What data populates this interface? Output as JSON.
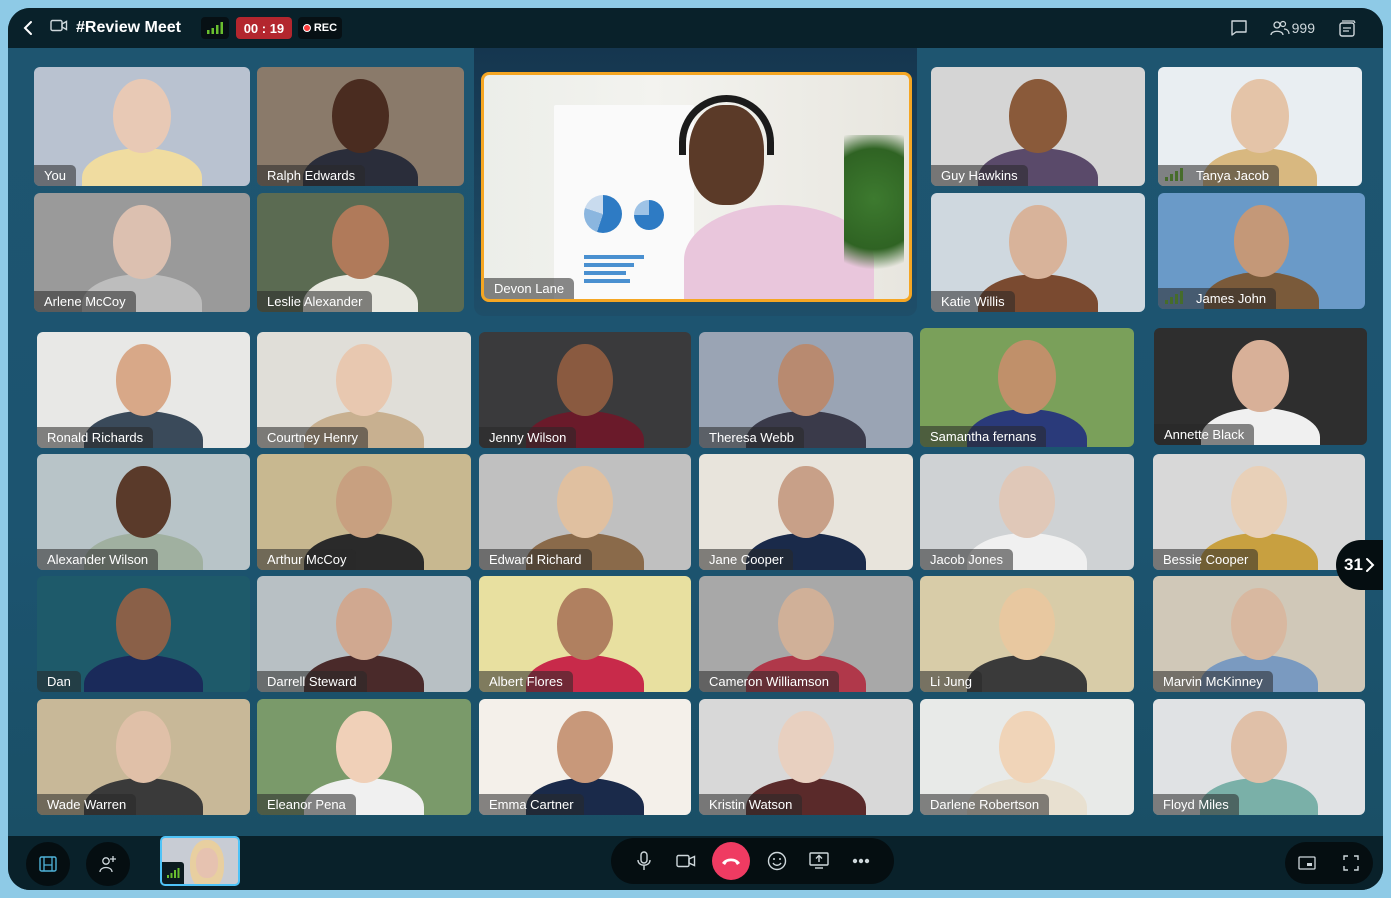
{
  "header": {
    "title": "#Review Meet",
    "timer": "00 : 19",
    "rec_label": "REC",
    "participants_count": "999",
    "icons": {
      "back": "chevron-left-icon",
      "meeting": "video-camera-icon",
      "signal": "signal-strength-icon",
      "chat": "chat-bubble-icon",
      "participants": "people-icon",
      "notes": "notes-stack-icon"
    }
  },
  "featured": {
    "name": "Devon Lane",
    "border_color": "#f5a623"
  },
  "top_tiles": [
    {
      "name": "You"
    },
    {
      "name": "Ralph Edwards"
    },
    {
      "name": "Arlene McCoy"
    },
    {
      "name": "Leslie Alexander"
    },
    {
      "name": "Guy Hawkins"
    },
    {
      "name": "Tanya Jacob",
      "signal": true
    },
    {
      "name": "Katie Willis"
    },
    {
      "name": "James John",
      "signal": true
    }
  ],
  "grid_rows": [
    [
      "Ronald Richards",
      "Courtney Henry",
      "Jenny Wilson",
      "Theresa Webb",
      "Samantha fernans",
      "Annette Black"
    ],
    [
      "Alexander Wilson",
      "Arthur McCoy",
      "Edward Richard",
      "Jane Cooper",
      "Jacob Jones",
      "Bessie Cooper"
    ],
    [
      "Dan",
      "Darrell Steward",
      "Albert Flores",
      "Cameron Williamson",
      "Li Jung",
      "Marvin McKinney"
    ],
    [
      "Wade Warren",
      "Eleanor Pena",
      "Emma Cartner",
      "Kristin Watson",
      "Darlene Robertson",
      "Floyd Miles"
    ]
  ],
  "pagination": {
    "remaining": "31"
  },
  "bottom_bar": {
    "left_buttons": [
      "layout-grid-icon",
      "add-participant-icon"
    ],
    "controls": [
      "microphone-icon",
      "video-camera-icon",
      "end-call-icon",
      "emoji-icon",
      "share-screen-icon",
      "more-icon"
    ],
    "right_controls": [
      "picture-in-picture-icon",
      "fullscreen-icon"
    ],
    "end_call_color": "#ef3b62"
  },
  "colors": {
    "stage_bg": "#1e5570",
    "bar_bg": "#09212a",
    "timer_bg": "#b3262e",
    "signal_green": "#6abf2f",
    "self_border": "#4fc3f7"
  }
}
